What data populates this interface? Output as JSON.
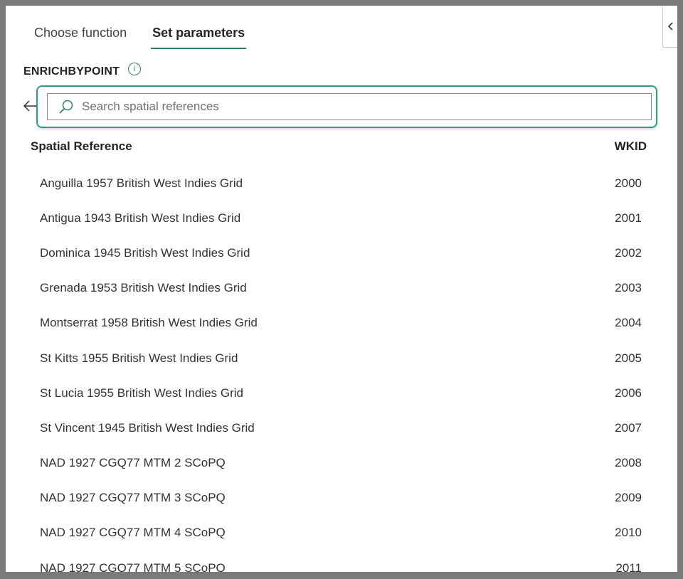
{
  "tabs": [
    {
      "label": "Choose function"
    },
    {
      "label": "Set parameters"
    }
  ],
  "function_name": "ENRICHBYPOINT",
  "search": {
    "placeholder": "Search spatial references",
    "value": ""
  },
  "table": {
    "columns": [
      "Spatial Reference",
      "WKID"
    ],
    "rows": [
      {
        "name": "Anguilla 1957 British West Indies Grid",
        "wkid": "2000"
      },
      {
        "name": "Antigua 1943 British West Indies Grid",
        "wkid": "2001"
      },
      {
        "name": "Dominica 1945 British West Indies Grid",
        "wkid": "2002"
      },
      {
        "name": "Grenada 1953 British West Indies Grid",
        "wkid": "2003"
      },
      {
        "name": "Montserrat 1958 British West Indies Grid",
        "wkid": "2004"
      },
      {
        "name": "St Kitts 1955 British West Indies Grid",
        "wkid": "2005"
      },
      {
        "name": "St Lucia 1955 British West Indies Grid",
        "wkid": "2006"
      },
      {
        "name": "St Vincent 1945 British West Indies Grid",
        "wkid": "2007"
      },
      {
        "name": "NAD 1927 CGQ77 MTM 2 SCoPQ",
        "wkid": "2008"
      },
      {
        "name": "NAD 1927 CGQ77 MTM 3 SCoPQ",
        "wkid": "2009"
      },
      {
        "name": "NAD 1927 CGQ77 MTM 4 SCoPQ",
        "wkid": "2010"
      },
      {
        "name": "NAD 1927 CGQ77 MTM 5 SCoPQ",
        "wkid": "2011"
      }
    ]
  },
  "icons": {
    "collapse": "chevron-left-icon",
    "info": "info-icon",
    "back": "back-arrow-icon",
    "search": "search-icon"
  },
  "colors": {
    "accent": "#2a7f62",
    "focus_ring": "#27a08a"
  }
}
